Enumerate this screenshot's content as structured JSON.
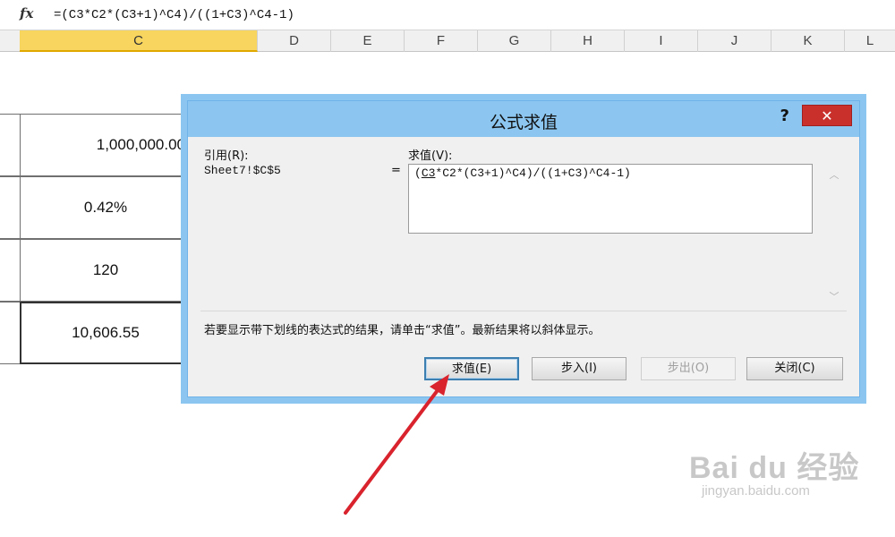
{
  "formula_bar": {
    "fx_label": "fx",
    "formula": "=(C3*C2*(C3+1)^C4)/((1+C3)^C4-1)"
  },
  "columns": [
    "C",
    "D",
    "E",
    "F",
    "G",
    "H",
    "I",
    "J",
    "K",
    "L"
  ],
  "selected_column": "C",
  "cells": [
    "1,000,000.00",
    "0.42%",
    "120",
    "10,606.55"
  ],
  "dialog": {
    "title": "公式求值",
    "help": "?",
    "close": "✕",
    "reference_label": "引用(R):",
    "reference_value": "Sheet7!$C$5",
    "equals": "=",
    "evaluation_label": "求值(V):",
    "evaluation_first": "C3",
    "evaluation_rest": "*C2*(C3+1)^C4)/((1+C3)^C4-1)",
    "evaluation_open": "(",
    "hint": "若要显示带下划线的表达式的结果，请单击“求值”。最新结果将以斜体显示。",
    "buttons": {
      "evaluate": "求值(E)",
      "step_in": "步入(I)",
      "step_out": "步出(O)",
      "close": "关闭(C)"
    }
  },
  "watermark": {
    "main": "Bai du 经验",
    "sub": "jingyan.baidu.com"
  },
  "colors": {
    "dialog_frame": "#8cc6f0",
    "close_button": "#c9302c",
    "selected_column": "#f7d55e",
    "arrow": "#d9232d"
  }
}
